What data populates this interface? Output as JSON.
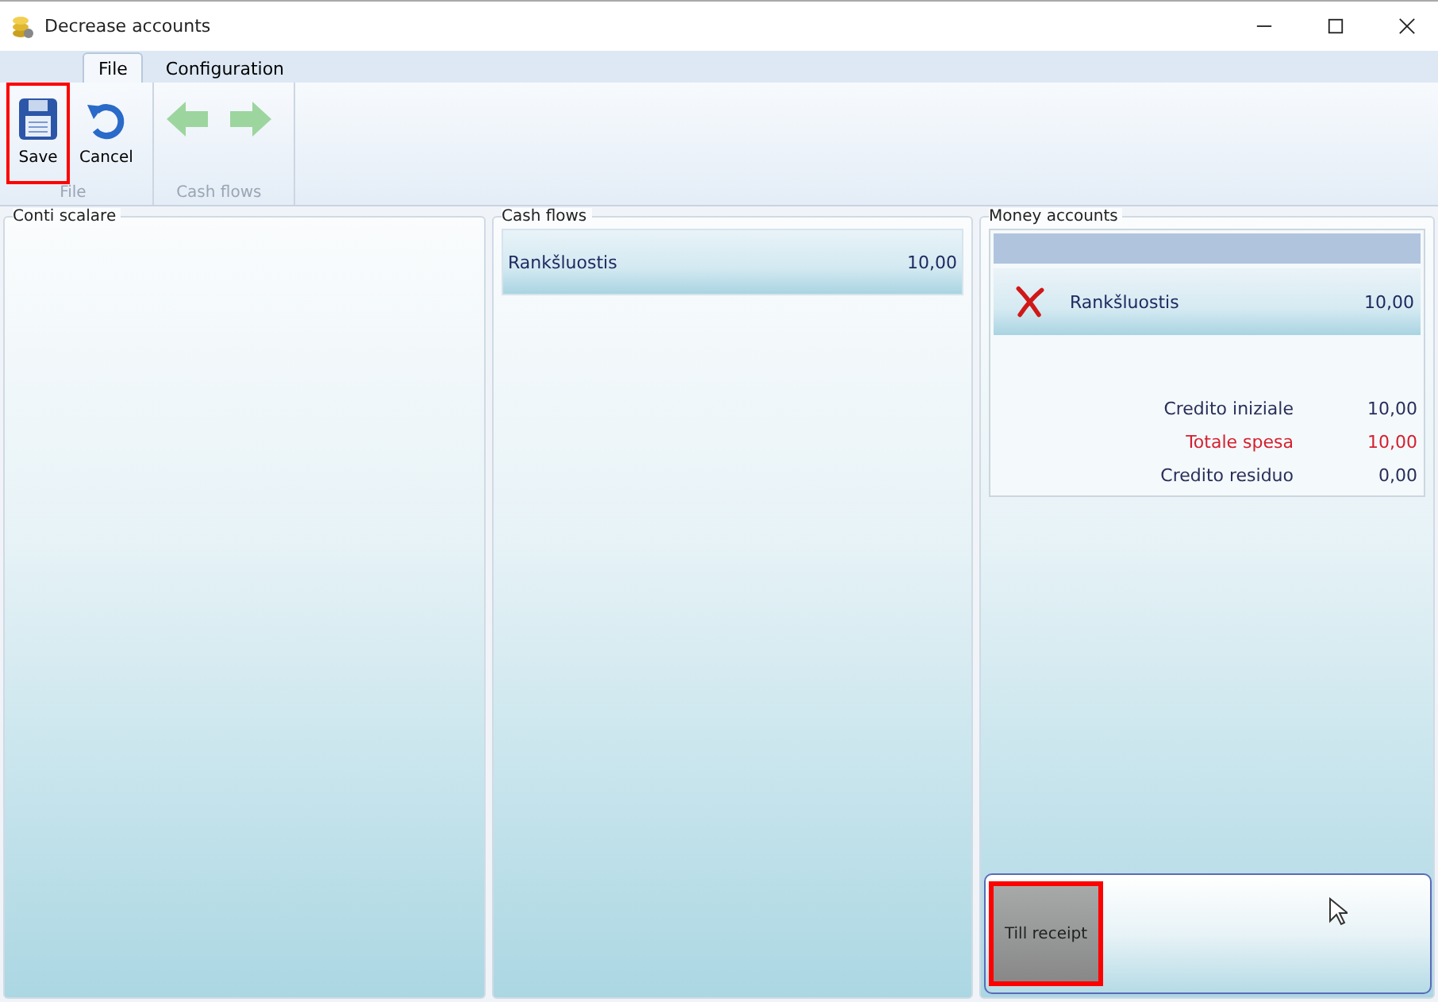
{
  "window": {
    "title": "Decrease accounts"
  },
  "tabs": [
    {
      "label": "File",
      "selected": true
    },
    {
      "label": "Configuration",
      "selected": false
    }
  ],
  "ribbon_groups": [
    {
      "label": "File",
      "buttons": [
        {
          "kind": "save",
          "label": "Save",
          "disabled": false,
          "highlighted": true
        },
        {
          "kind": "cancel",
          "label": "Cancel",
          "disabled": false,
          "highlighted": false
        }
      ]
    },
    {
      "label": "Cash flows",
      "buttons": [
        {
          "kind": "back",
          "disabled": true,
          "highlighted": false
        },
        {
          "kind": "forward",
          "disabled": true,
          "highlighted": false
        }
      ]
    }
  ],
  "panels": [
    {
      "title": "Conti scalare"
    },
    {
      "title": "Cash flows",
      "rows": [
        {
          "name": "Rankšluostis",
          "amount": "10,00"
        }
      ]
    },
    {
      "title": "Money accounts",
      "accounts": [
        {
          "name": "Rankšluostis",
          "amount": "10,00"
        }
      ],
      "totals": [
        {
          "label": "Credito iniziale",
          "value": "10,00",
          "alert": false
        },
        {
          "label": "Totale spesa",
          "value": "10,00",
          "alert": true
        },
        {
          "label": "Credito residuo",
          "value": "0,00",
          "alert": false
        }
      ]
    }
  ],
  "till_receipt": {
    "label": "Till receipt",
    "highlighted": true
  }
}
